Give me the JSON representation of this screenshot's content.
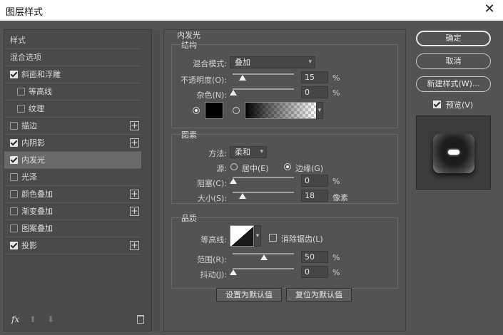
{
  "window": {
    "title": "图层样式",
    "close_glyph": "✕"
  },
  "styles_list": {
    "header": "样式",
    "blend_options": "混合选项",
    "items": [
      {
        "label": "斜面和浮雕",
        "checked": true,
        "plus": false,
        "indent": false
      },
      {
        "label": "等高线",
        "checked": false,
        "plus": false,
        "indent": true
      },
      {
        "label": "纹理",
        "checked": false,
        "plus": false,
        "indent": true
      },
      {
        "label": "描边",
        "checked": false,
        "plus": true,
        "indent": false
      },
      {
        "label": "内阴影",
        "checked": true,
        "plus": true,
        "indent": false
      },
      {
        "label": "内发光",
        "checked": true,
        "plus": false,
        "indent": false,
        "selected": true
      },
      {
        "label": "光泽",
        "checked": false,
        "plus": false,
        "indent": false
      },
      {
        "label": "颜色叠加",
        "checked": false,
        "plus": true,
        "indent": false
      },
      {
        "label": "渐变叠加",
        "checked": false,
        "plus": true,
        "indent": false
      },
      {
        "label": "图案叠加",
        "checked": false,
        "plus": false,
        "indent": false
      },
      {
        "label": "投影",
        "checked": true,
        "plus": true,
        "indent": false
      }
    ],
    "plus_glyph": "+",
    "footer": {
      "fx": "fx",
      "up": "⬆",
      "down": "⬇"
    }
  },
  "inner_glow": {
    "title": "内发光",
    "structure": {
      "title": "结构",
      "blend_mode_label": "混合模式:",
      "blend_mode_value": "叠加",
      "opacity_label": "不透明度(O):",
      "opacity_value": "15",
      "opacity_unit": "%",
      "noise_label": "杂色(N):",
      "noise_value": "0",
      "noise_unit": "%"
    },
    "elements": {
      "title": "图素",
      "method_label": "方法:",
      "method_value": "柔和",
      "source_label": "源:",
      "source_center": "居中(E)",
      "source_edge": "边缘(G)",
      "choke_label": "阻塞(C):",
      "choke_value": "0",
      "choke_unit": "%",
      "size_label": "大小(S):",
      "size_value": "18",
      "size_unit": "像素"
    },
    "quality": {
      "title": "品质",
      "contour_label": "等高线:",
      "antialias_label": "消除锯齿(L)",
      "range_label": "范围(R):",
      "range_value": "50",
      "range_unit": "%",
      "jitter_label": "抖动(J):",
      "jitter_value": "0",
      "jitter_unit": "%"
    },
    "buttons": {
      "set_default": "设置为默认值",
      "reset_default": "复位为默认值"
    }
  },
  "right_panel": {
    "ok": "确定",
    "cancel": "取消",
    "new_style": "新建样式(W)...",
    "preview_label": "预览(V)"
  },
  "colors": {
    "glow_color": "#000000",
    "accent_selected": "#6a6a6a"
  }
}
